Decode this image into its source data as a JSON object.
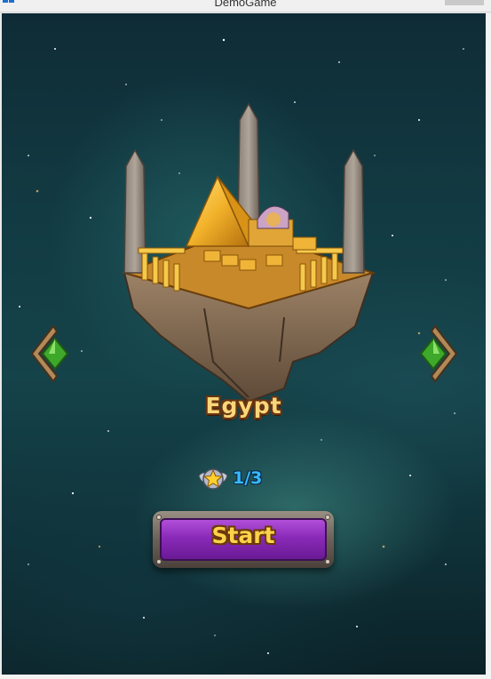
{
  "window": {
    "title": "DemoGame"
  },
  "level": {
    "name": "Egypt",
    "stars_collected": 1,
    "stars_total": 3,
    "progress_text": "1/3"
  },
  "start_button": {
    "label": "Start"
  },
  "colors": {
    "title_gold": "#f9d67a",
    "progress_blue": "#39b8ff",
    "button_purple": "#8a2ab8",
    "button_text": "#ffd24a",
    "gem_green": "#3ea82a"
  },
  "icons": {
    "window_icon": "app-window-icon",
    "prev": "arrow-left-gem-icon",
    "next": "arrow-right-gem-icon",
    "star_badge": "winged-star-badge-icon",
    "island": "egypt-floating-island-illustration"
  }
}
